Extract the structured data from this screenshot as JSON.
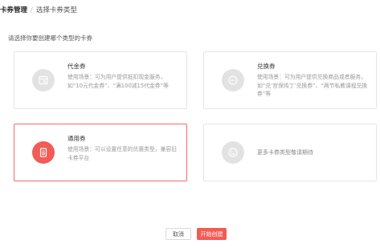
{
  "breadcrumb": {
    "root": "卡券管理",
    "separator": "/",
    "current": "选择卡券类型"
  },
  "prompt": "请选择你要创建哪个类型的卡券",
  "cards": {
    "voucher": {
      "title": "代金券",
      "desc": "使用场景：可为用户提供抵扣现金服务，如“10元代金券”、“满100减15代金券”等",
      "icon": "voucher-icon",
      "selected": false
    },
    "exchange": {
      "title": "兑换券",
      "desc": "使用场景：可为用户提供兑换商品或者服务，如“兑‘宫保鸡丁’兑换券”、“两节私教课程兑换券”等",
      "icon": "exchange-icon",
      "selected": false
    },
    "general": {
      "title": "通用券",
      "desc": "使用场景：可以设置任意的优惠类型，兼容旧卡券平台",
      "icon": "general-coupon-icon",
      "selected": true
    },
    "more": {
      "text": "更多卡券类型敬请期待",
      "icon": "smile-icon",
      "selected": false
    }
  },
  "footer": {
    "cancel_label": "取消",
    "create_label": "开始创建"
  },
  "colors": {
    "accent": "#f35b55",
    "selected_border": "#f16a67",
    "icon_inactive": "#e2e2e2",
    "card_border": "#e6e6e6"
  }
}
